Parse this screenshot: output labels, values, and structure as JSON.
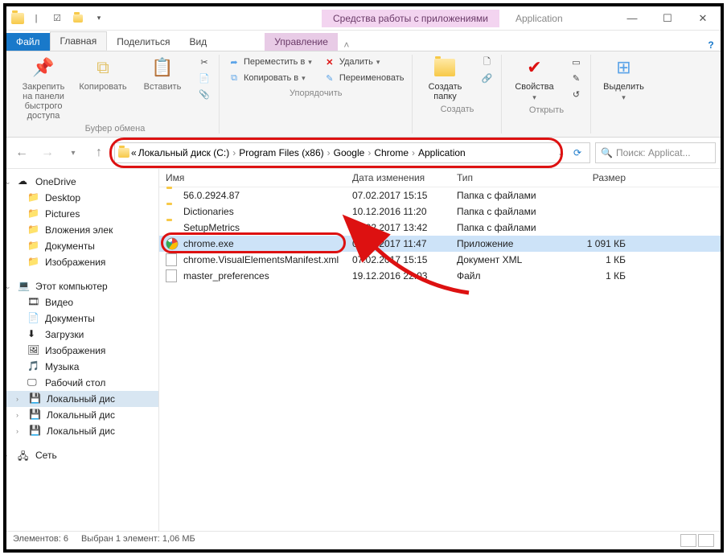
{
  "title_context": "Средства работы с приложениями",
  "title_app": "Application",
  "tabs": {
    "file": "Файл",
    "home": "Главная",
    "share": "Поделиться",
    "view": "Вид",
    "manage": "Управление"
  },
  "ribbon": {
    "clipboard": {
      "pin": "Закрепить на панели быстрого доступа",
      "copy": "Копировать",
      "paste": "Вставить",
      "label": "Буфер обмена"
    },
    "organize": {
      "move": "Переместить в",
      "copy_to": "Копировать в",
      "delete": "Удалить",
      "rename": "Переименовать",
      "label": "Упорядочить"
    },
    "new": {
      "folder": "Создать папку",
      "label": "Создать"
    },
    "open": {
      "props": "Свойства",
      "label": "Открыть"
    },
    "select": {
      "select": "Выделить"
    }
  },
  "breadcrumbs": [
    "Локальный диск (C:)",
    "Program Files (x86)",
    "Google",
    "Chrome",
    "Application"
  ],
  "breadcrumb_prefix": "«",
  "search_placeholder": "Поиск: Applicat...",
  "columns": {
    "name": "Имя",
    "date": "Дата изменения",
    "type": "Тип",
    "size": "Размер"
  },
  "tree": {
    "onedrive": "OneDrive",
    "desktop": "Desktop",
    "pictures": "Pictures",
    "attachments": "Вложения элек",
    "documents": "Документы",
    "images": "Изображения",
    "thispc": "Этот компьютер",
    "video": "Видео",
    "docs2": "Документы",
    "downloads": "Загрузки",
    "images2": "Изображения",
    "music": "Музыка",
    "desktop2": "Рабочий стол",
    "localdisk": "Локальный дис",
    "localdisk2": "Локальный дис",
    "localdisk3": "Локальный дис",
    "network": "Сеть"
  },
  "files": [
    {
      "name": "56.0.2924.87",
      "date": "07.02.2017 15:15",
      "type": "Папка с файлами",
      "size": "",
      "icon": "folder"
    },
    {
      "name": "Dictionaries",
      "date": "10.12.2016 11:20",
      "type": "Папка с файлами",
      "size": "",
      "icon": "folder"
    },
    {
      "name": "SetupMetrics",
      "date": "17.02.2017 13:42",
      "type": "Папка с файлами",
      "size": "",
      "icon": "folder"
    },
    {
      "name": "chrome.exe",
      "date": "01.02.2017 11:47",
      "type": "Приложение",
      "size": "1 091 КБ",
      "icon": "chrome",
      "selected": true,
      "highlighted": true
    },
    {
      "name": "chrome.VisualElementsManifest.xml",
      "date": "07.02.2017 15:15",
      "type": "Документ XML",
      "size": "1 КБ",
      "icon": "file"
    },
    {
      "name": "master_preferences",
      "date": "19.12.2016 22:03",
      "type": "Файл",
      "size": "1 КБ",
      "icon": "file"
    }
  ],
  "status": {
    "count": "Элементов: 6",
    "selected": "Выбран 1 элемент: 1,06 МБ"
  }
}
